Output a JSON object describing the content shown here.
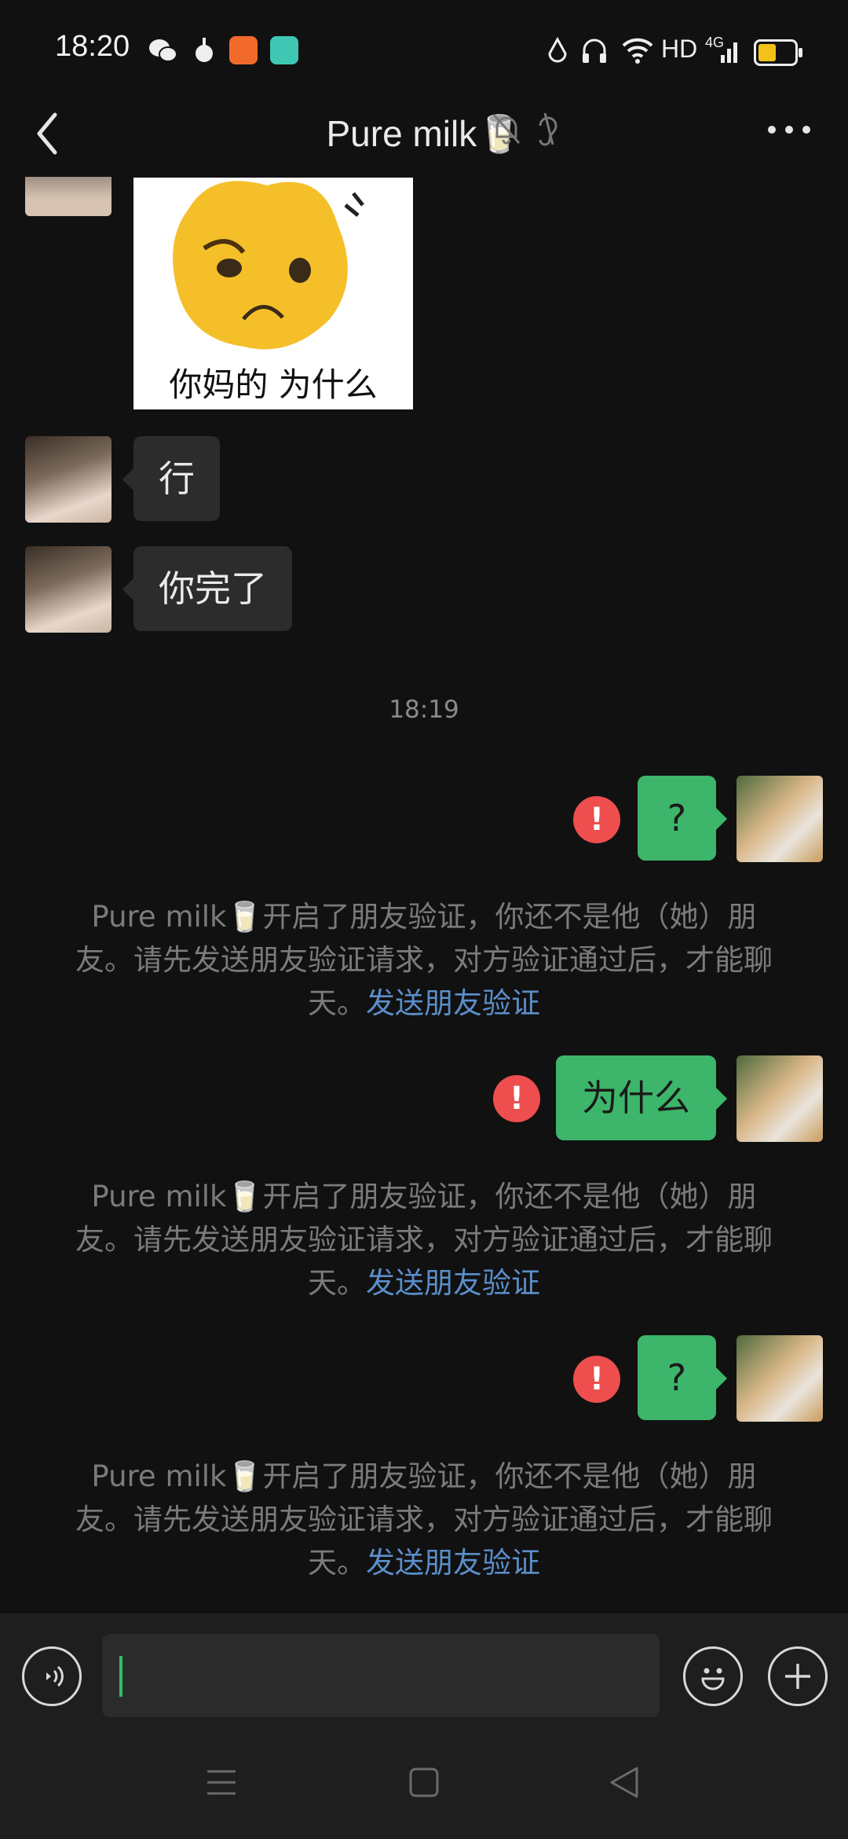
{
  "status_bar": {
    "time": "18:20",
    "network_label": "HD",
    "signal_label": "4G"
  },
  "header": {
    "title": "Pure milk🥛"
  },
  "messages": {
    "incoming_1": "行",
    "incoming_2": "你完了",
    "sticker_caption": "你妈的 为什么",
    "timestamp": "18:19",
    "outgoing_1": "?",
    "outgoing_2": "为什么",
    "outgoing_3": "?"
  },
  "system_notice": {
    "text": "Pure milk🥛开启了朋友验证，你还不是他（她）朋友。请先发送朋友验证请求，对方验证通过后，才能聊天。",
    "link": "发送朋友验证"
  },
  "input": {
    "value": "",
    "placeholder": ""
  },
  "colors": {
    "background": "#111111",
    "outgoing_bubble": "#3db56a",
    "incoming_bubble": "#2c2c2c",
    "error_badge": "#ee4e4e",
    "link": "#5b8fca",
    "caret": "#2fbe6a"
  }
}
